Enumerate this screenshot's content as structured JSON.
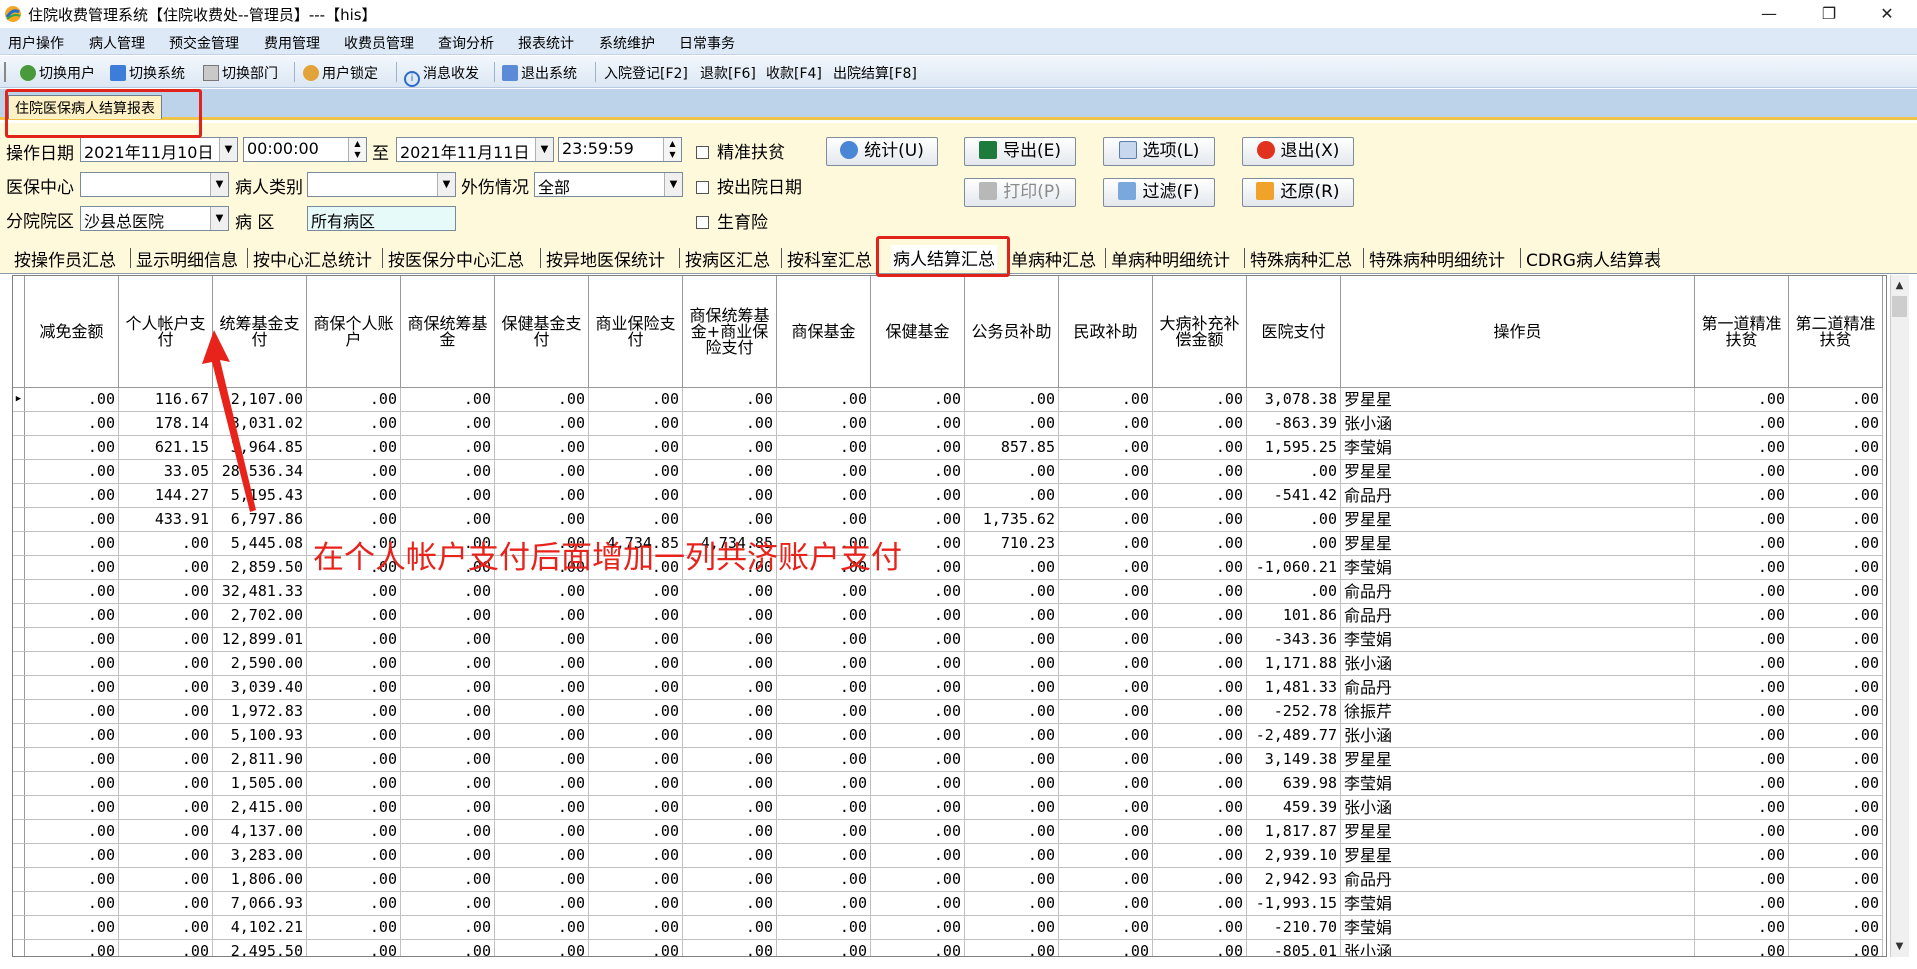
{
  "window": {
    "title": "住院收费管理系统【住院收费处--管理员】---【his】",
    "minimize": "—",
    "maximize": "❐",
    "close": "✕"
  },
  "menu": [
    "用户操作",
    "病人管理",
    "预交金管理",
    "费用管理",
    "收费员管理",
    "查询分析",
    "报表统计",
    "系统维护",
    "日常事务"
  ],
  "toolbar": {
    "switch_user": "切换用户",
    "switch_system": "切换系统",
    "switch_dept": "切换部门",
    "lock_user": "用户锁定",
    "messages": "消息收发",
    "exit_system": "退出系统",
    "admission": "入院登记[F2]",
    "refund": "退款[F6]",
    "charge": "收款[F4]",
    "discharge": "出院结算[F8]"
  },
  "doc_tab": "住院医保病人结算报表",
  "filter": {
    "op_date_label": "操作日期",
    "date_from": "2021年11月10日",
    "time_from": "00:00:00",
    "to_label": "至",
    "date_to": "2021年11月11日",
    "time_to": "23:59:59",
    "insurance_center_label": "医保中心",
    "insurance_center_value": "",
    "patient_type_label": "病人类别",
    "patient_type_value": "",
    "injury_label": "外伤情况",
    "injury_value": "全部",
    "branch_label": "分院院区",
    "branch_value": "沙县总医院",
    "ward_label": "病 区",
    "ward_value": "所有病区",
    "chk_poverty": "精准扶贫",
    "chk_discharge_date": "按出院日期",
    "chk_maternity": "生育险",
    "btn_stat": "统计(U)",
    "btn_export": "导出(E)",
    "btn_options": "选项(L)",
    "btn_exit": "退出(X)",
    "btn_print": "打印(P)",
    "btn_filter": "过滤(F)",
    "btn_restore": "还原(R)"
  },
  "report_tabs": [
    "按操作员汇总",
    "显示明细信息",
    "按中心汇总统计",
    "按医保分中心汇总",
    "按异地医保统计",
    "按病区汇总",
    "按科室汇总",
    "病人结算汇总",
    "单病种汇总",
    "单病种明细统计",
    "特殊病种汇总",
    "特殊病种明细统计",
    "CDRG病人结算表"
  ],
  "active_tab": "病人结算汇总",
  "grid": {
    "columns": [
      "减免金额",
      "个人帐户支付",
      "统筹基金支付",
      "商保个人账户",
      "商保统筹基金",
      "保健基金支付",
      "商业保险支付",
      "商保统筹基金+商业保险支付",
      "商保基金",
      "保健基金",
      "公务员补助",
      "民政补助",
      "大病补充补偿金额",
      "医院支付",
      "操作员",
      "第一道精准扶贫",
      "第二道精准扶贫"
    ],
    "rows": [
      [
        ".00",
        "116.67",
        "2,107.00",
        ".00",
        ".00",
        ".00",
        ".00",
        ".00",
        ".00",
        ".00",
        ".00",
        ".00",
        ".00",
        "3,078.38",
        "罗星星",
        ".00",
        ".00"
      ],
      [
        ".00",
        "178.14",
        "3,031.02",
        ".00",
        ".00",
        ".00",
        ".00",
        ".00",
        ".00",
        ".00",
        ".00",
        ".00",
        ".00",
        "-863.39",
        "张小涵",
        ".00",
        ".00"
      ],
      [
        ".00",
        "621.15",
        "3,964.85",
        ".00",
        ".00",
        ".00",
        ".00",
        ".00",
        ".00",
        ".00",
        "857.85",
        ".00",
        ".00",
        "1,595.25",
        "李莹娟",
        ".00",
        ".00"
      ],
      [
        ".00",
        "33.05",
        "28,536.34",
        ".00",
        ".00",
        ".00",
        ".00",
        ".00",
        ".00",
        ".00",
        ".00",
        ".00",
        ".00",
        ".00",
        "罗星星",
        ".00",
        ".00"
      ],
      [
        ".00",
        "144.27",
        "5,195.43",
        ".00",
        ".00",
        ".00",
        ".00",
        ".00",
        ".00",
        ".00",
        ".00",
        ".00",
        ".00",
        "-541.42",
        "俞品丹",
        ".00",
        ".00"
      ],
      [
        ".00",
        "433.91",
        "6,797.86",
        ".00",
        ".00",
        ".00",
        ".00",
        ".00",
        ".00",
        ".00",
        "1,735.62",
        ".00",
        ".00",
        ".00",
        "罗星星",
        ".00",
        ".00"
      ],
      [
        ".00",
        ".00",
        "5,445.08",
        ".00",
        ".00",
        ".00",
        "4,734.85",
        "4,734.85",
        ".00",
        ".00",
        "710.23",
        ".00",
        ".00",
        ".00",
        "罗星星",
        ".00",
        ".00"
      ],
      [
        ".00",
        ".00",
        "2,859.50",
        ".00",
        ".00",
        ".00",
        ".00",
        ".00",
        ".00",
        ".00",
        ".00",
        ".00",
        ".00",
        "-1,060.21",
        "李莹娟",
        ".00",
        ".00"
      ],
      [
        ".00",
        ".00",
        "32,481.33",
        ".00",
        ".00",
        ".00",
        ".00",
        ".00",
        ".00",
        ".00",
        ".00",
        ".00",
        ".00",
        ".00",
        "俞品丹",
        ".00",
        ".00"
      ],
      [
        ".00",
        ".00",
        "2,702.00",
        ".00",
        ".00",
        ".00",
        ".00",
        ".00",
        ".00",
        ".00",
        ".00",
        ".00",
        ".00",
        "101.86",
        "俞品丹",
        ".00",
        ".00"
      ],
      [
        ".00",
        ".00",
        "12,899.01",
        ".00",
        ".00",
        ".00",
        ".00",
        ".00",
        ".00",
        ".00",
        ".00",
        ".00",
        ".00",
        "-343.36",
        "李莹娟",
        ".00",
        ".00"
      ],
      [
        ".00",
        ".00",
        "2,590.00",
        ".00",
        ".00",
        ".00",
        ".00",
        ".00",
        ".00",
        ".00",
        ".00",
        ".00",
        ".00",
        "1,171.88",
        "张小涵",
        ".00",
        ".00"
      ],
      [
        ".00",
        ".00",
        "3,039.40",
        ".00",
        ".00",
        ".00",
        ".00",
        ".00",
        ".00",
        ".00",
        ".00",
        ".00",
        ".00",
        "1,481.33",
        "俞品丹",
        ".00",
        ".00"
      ],
      [
        ".00",
        ".00",
        "1,972.83",
        ".00",
        ".00",
        ".00",
        ".00",
        ".00",
        ".00",
        ".00",
        ".00",
        ".00",
        ".00",
        "-252.78",
        "徐振芹",
        ".00",
        ".00"
      ],
      [
        ".00",
        ".00",
        "5,100.93",
        ".00",
        ".00",
        ".00",
        ".00",
        ".00",
        ".00",
        ".00",
        ".00",
        ".00",
        ".00",
        "-2,489.77",
        "张小涵",
        ".00",
        ".00"
      ],
      [
        ".00",
        ".00",
        "2,811.90",
        ".00",
        ".00",
        ".00",
        ".00",
        ".00",
        ".00",
        ".00",
        ".00",
        ".00",
        ".00",
        "3,149.38",
        "罗星星",
        ".00",
        ".00"
      ],
      [
        ".00",
        ".00",
        "1,505.00",
        ".00",
        ".00",
        ".00",
        ".00",
        ".00",
        ".00",
        ".00",
        ".00",
        ".00",
        ".00",
        "639.98",
        "李莹娟",
        ".00",
        ".00"
      ],
      [
        ".00",
        ".00",
        "2,415.00",
        ".00",
        ".00",
        ".00",
        ".00",
        ".00",
        ".00",
        ".00",
        ".00",
        ".00",
        ".00",
        "459.39",
        "张小涵",
        ".00",
        ".00"
      ],
      [
        ".00",
        ".00",
        "4,137.00",
        ".00",
        ".00",
        ".00",
        ".00",
        ".00",
        ".00",
        ".00",
        ".00",
        ".00",
        ".00",
        "1,817.87",
        "罗星星",
        ".00",
        ".00"
      ],
      [
        ".00",
        ".00",
        "3,283.00",
        ".00",
        ".00",
        ".00",
        ".00",
        ".00",
        ".00",
        ".00",
        ".00",
        ".00",
        ".00",
        "2,939.10",
        "罗星星",
        ".00",
        ".00"
      ],
      [
        ".00",
        ".00",
        "1,806.00",
        ".00",
        ".00",
        ".00",
        ".00",
        ".00",
        ".00",
        ".00",
        ".00",
        ".00",
        ".00",
        "2,942.93",
        "俞品丹",
        ".00",
        ".00"
      ],
      [
        ".00",
        ".00",
        "7,066.93",
        ".00",
        ".00",
        ".00",
        ".00",
        ".00",
        ".00",
        ".00",
        ".00",
        ".00",
        ".00",
        "-1,993.15",
        "李莹娟",
        ".00",
        ".00"
      ],
      [
        ".00",
        ".00",
        "4,102.21",
        ".00",
        ".00",
        ".00",
        ".00",
        ".00",
        ".00",
        ".00",
        ".00",
        ".00",
        ".00",
        "-210.70",
        "李莹娟",
        ".00",
        ".00"
      ],
      [
        ".00",
        ".00",
        "2,495.50",
        ".00",
        ".00",
        ".00",
        ".00",
        ".00",
        ".00",
        ".00",
        ".00",
        ".00",
        ".00",
        "-805.01",
        "张小涵",
        ".00",
        ".00"
      ]
    ]
  },
  "annotation": {
    "text": "在个人帐户支付后面增加一列共济账户支付",
    "color": "#e8231c"
  }
}
